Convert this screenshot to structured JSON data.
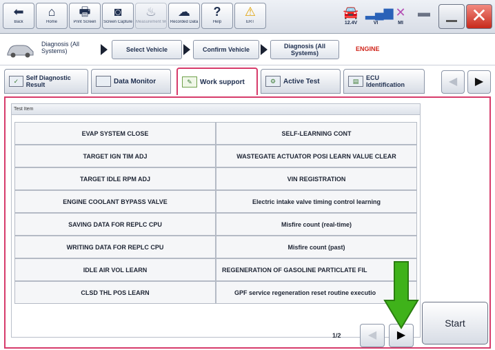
{
  "toolbar": {
    "buttons": [
      {
        "label": "Back",
        "icon": "back-arrow-icon",
        "glyph": "⬅"
      },
      {
        "label": "Home",
        "icon": "home-icon",
        "glyph": "⌂"
      },
      {
        "label": "Print Screen",
        "icon": "print-icon",
        "glyph": "🖶"
      },
      {
        "label": "Screen Capture",
        "icon": "camera-icon",
        "glyph": "◙"
      },
      {
        "label": "Measurement Mode",
        "icon": "measurement-icon",
        "glyph": "♨"
      },
      {
        "label": "Recorded Data",
        "icon": "recorded-data-icon",
        "glyph": "☁"
      },
      {
        "label": "Help",
        "icon": "help-icon",
        "glyph": "?"
      },
      {
        "label": "ERT",
        "icon": "warning-icon",
        "glyph": "⚠"
      }
    ],
    "status": {
      "voltage": "12.4V",
      "vi": "VI",
      "mi": "MI"
    }
  },
  "breadcrumb": {
    "first": "Diagnosis (All Systems)",
    "items": [
      "Select Vehicle",
      "Confirm Vehicle",
      "Diagnosis (All Systems)"
    ],
    "active": "ENGINE"
  },
  "tabs": [
    {
      "label": "Self Diagnostic Result"
    },
    {
      "label": "Data Monitor"
    },
    {
      "label": "Work support"
    },
    {
      "label": "Active Test"
    },
    {
      "label": "ECU Identification"
    }
  ],
  "tab_nav": {
    "prev": "◀",
    "next": "▶"
  },
  "table": {
    "header": "Test Item",
    "rows": [
      [
        "EVAP SYSTEM CLOSE",
        "SELF-LEARNING CONT"
      ],
      [
        "TARGET IGN TIM ADJ",
        "WASTEGATE ACTUATOR POSI LEARN VALUE CLEAR"
      ],
      [
        "TARGET IDLE RPM ADJ",
        "VIN REGISTRATION"
      ],
      [
        "ENGINE COOLANT BYPASS VALVE",
        "Electric intake valve timing control learning"
      ],
      [
        "SAVING DATA FOR REPLC CPU",
        "Misfire count (real-time)"
      ],
      [
        "WRITING DATA FOR REPLC CPU",
        "Misfire count (past)"
      ],
      [
        "IDLE AIR VOL LEARN",
        "REGENERATION OF GASOLINE PARTICLATE FIL"
      ],
      [
        "CLSD THL POS LEARN",
        "GPF service regeneration reset routine executio"
      ]
    ]
  },
  "pagination": {
    "indicator": "1/2",
    "prev": "◀",
    "next": "▶"
  },
  "start_label": "Start",
  "colors": {
    "accent": "#d63a6a",
    "active_crumb": "#d0241a",
    "arrow": "#3fb21a"
  }
}
